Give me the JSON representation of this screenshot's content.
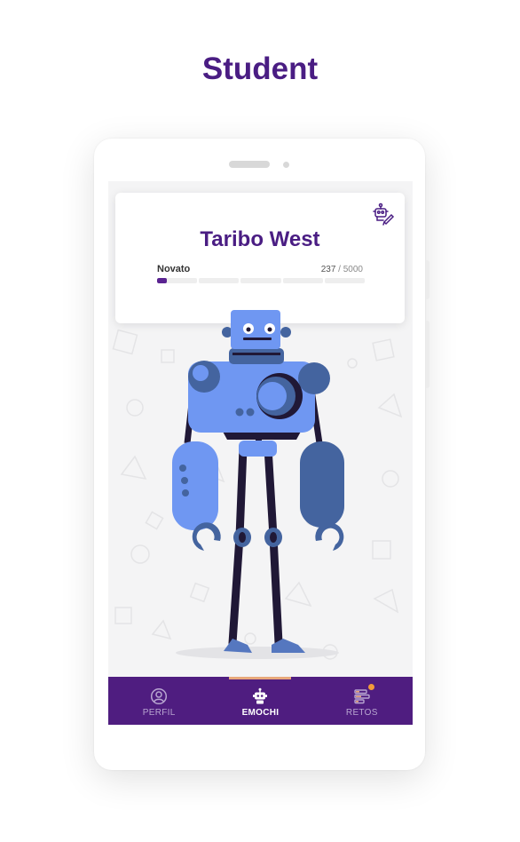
{
  "page": {
    "heading": "Student"
  },
  "profile": {
    "name": "Taribo West",
    "level": "Novato",
    "xp_current": "237",
    "xp_total": "5000",
    "xp_separator": " / ",
    "xp_progress": 0.0474,
    "edit_icon": "robot-edit-icon"
  },
  "tabs": [
    {
      "label": "PERFIL",
      "icon": "user-icon",
      "active": false
    },
    {
      "label": "EMOCHI",
      "icon": "robot-icon",
      "active": true
    },
    {
      "label": "RETOS",
      "icon": "challenges-icon",
      "active": false,
      "has_notification": true
    }
  ],
  "colors": {
    "brand_purple": "#4a1d83",
    "tab_bar": "#4f1d80",
    "robot_blue": "#6f97f2",
    "robot_dark_blue": "#44649f",
    "notification": "#f29a3a",
    "active_indicator": "#e8a87a"
  }
}
